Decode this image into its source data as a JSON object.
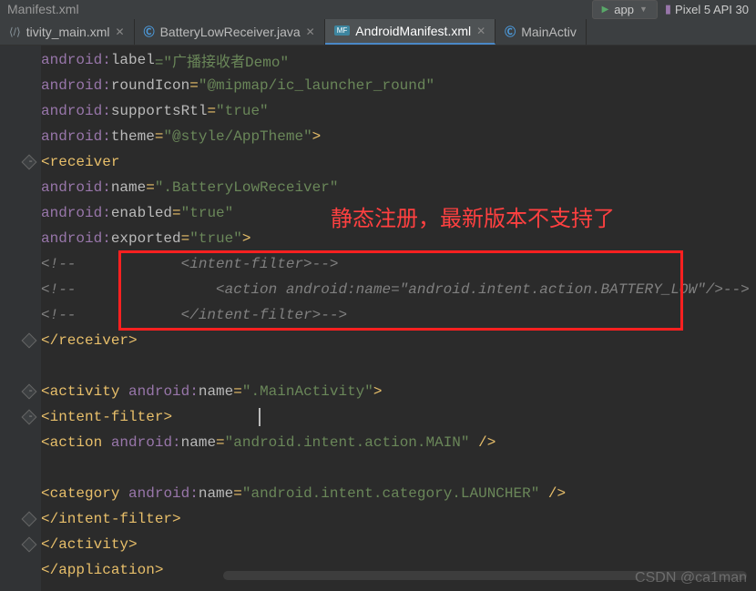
{
  "top": {
    "title": "Manifest.xml",
    "runConfig": "app",
    "device": "Pixel 5 API 30"
  },
  "tabs": [
    {
      "label": "tivity_main.xml",
      "icon": "x",
      "active": false
    },
    {
      "label": "BatteryLowReceiver.java",
      "icon": "c",
      "active": false
    },
    {
      "label": "AndroidManifest.xml",
      "icon": "mf",
      "active": true
    },
    {
      "label": "MainActiv",
      "icon": "c",
      "active": false,
      "noclose": true
    }
  ],
  "overlay": {
    "text": "静态注册，最新版本不支持了"
  },
  "watermark": "CSDN @ca1man",
  "code": {
    "comment_open": "<!--",
    "l1": {
      "ns": "android:",
      "attr": "label",
      "val": "=\"广播接收者Demo\""
    },
    "l2": {
      "ns": "android:",
      "attr": "roundIcon",
      "eq": "=",
      "val": "\"@mipmap/ic_launcher_round\""
    },
    "l3": {
      "ns": "android:",
      "attr": "supportsRtl",
      "eq": "=",
      "val": "\"true\""
    },
    "l4": {
      "ns": "android:",
      "attr": "theme",
      "eq": "=",
      "val": "\"@style/AppTheme\"",
      "close": ">"
    },
    "l5": {
      "open": "<",
      "tag": "receiver"
    },
    "l6": {
      "ns": "android:",
      "attr": "name",
      "eq": "=",
      "val": "\".BatteryLowReceiver\""
    },
    "l7": {
      "ns": "android:",
      "attr": "enabled",
      "eq": "=",
      "val": "\"true\""
    },
    "l8": {
      "ns": "android:",
      "attr": "exported",
      "eq": "=",
      "val": "\"true\"",
      "close": ">"
    },
    "l9": "            <intent-filter>-->",
    "l10": "                <action android:name=\"android.intent.action.BATTERY_LOW\"/>-->",
    "l11": "            </intent-filter>-->",
    "l12": {
      "open": "</",
      "tag": "receiver",
      "close": ">"
    },
    "l14": {
      "open": "<",
      "tag": "activity ",
      "ns": "android:",
      "attr": "name",
      "eq": "=",
      "val": "\".MainActivity\"",
      "close": ">"
    },
    "l15": {
      "open": "<",
      "tag": "intent-filter",
      "close": ">"
    },
    "l16": {
      "open": "<",
      "tag": "action ",
      "ns": "android:",
      "attr": "name",
      "eq": "=",
      "val": "\"android.intent.action.MAIN\" ",
      "close": "/>"
    },
    "l18": {
      "open": "<",
      "tag": "category ",
      "ns": "android:",
      "attr": "name",
      "eq": "=",
      "val": "\"android.intent.category.LAUNCHER\" ",
      "close": "/>"
    },
    "l19": {
      "open": "</",
      "tag": "intent-filter",
      "close": ">"
    },
    "l20": {
      "open": "</",
      "tag": "activity",
      "close": ">"
    },
    "l21": {
      "open": "</",
      "tag": "application",
      "close": ">"
    }
  }
}
